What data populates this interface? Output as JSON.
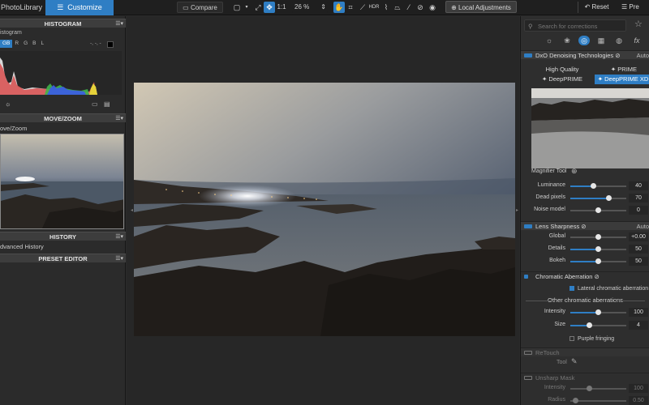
{
  "topbar": {
    "tab_photolibrary": "PhotoLibrary",
    "tab_customize": "Customize",
    "compare_label": "Compare",
    "zoom_one_to_one": "1:1",
    "zoom_level": "26 %",
    "local_adjustments_label": "Local Adjustments",
    "reset_label": "Reset",
    "preset_label": "Pre"
  },
  "left": {
    "histogram_title": "HISTOGRAM",
    "histogram_label": "istogram",
    "channels": [
      "GB",
      "R",
      "G",
      "B",
      "L"
    ],
    "histogram_readout": "-, -, -",
    "move_zoom_title": "MOVE/ZOOM",
    "move_zoom_label": "ove/Zoom",
    "history_title": "HISTORY",
    "history_item": "dvanced History",
    "preset_editor_title": "PRESET EDITOR"
  },
  "right": {
    "search_placeholder": "Search for corrections",
    "denoise": {
      "title": "DxO Denoising Technologies",
      "auto": "Auto",
      "mode_high_quality": "High Quality",
      "mode_prime": "PRIME",
      "mode_deepprime": "DeepPRIME",
      "mode_deepprime_xd": "DeepPRIME XD",
      "magnifier_label": "Magnifier Tool",
      "sliders": [
        {
          "label": "Luminance",
          "value": "40",
          "pct": 0.4
        },
        {
          "label": "Dead pixels",
          "value": "70",
          "pct": 0.68
        },
        {
          "label": "Noise model",
          "value": "0",
          "pct": 0.5
        }
      ]
    },
    "lens_sharpness": {
      "title": "Lens Sharpness",
      "auto": "Auto",
      "sliders": [
        {
          "label": "Global",
          "value": "+0.00",
          "pct": 0.5
        },
        {
          "label": "Details",
          "value": "50",
          "pct": 0.5
        },
        {
          "label": "Bokeh",
          "value": "50",
          "pct": 0.5
        }
      ]
    },
    "chromatic": {
      "title": "Chromatic Aberration",
      "lateral_label": "Lateral chromatic aberration",
      "other_label": "Other chromatic aberrations",
      "sliders": [
        {
          "label": "Intensity",
          "value": "100",
          "pct": 0.5
        },
        {
          "label": "Size",
          "value": "4",
          "pct": 0.33
        }
      ],
      "purple_label": "Purple fringing"
    },
    "retouch": {
      "title": "ReTouch",
      "tool_label": "Tool"
    },
    "unsharp": {
      "title": "Unsharp Mask",
      "sliders": [
        {
          "label": "Intensity",
          "value": "100",
          "pct": 0.33
        },
        {
          "label": "Radius",
          "value": "0.50",
          "pct": 0.08
        }
      ]
    }
  },
  "colors": {
    "accent": "#2f7ec4",
    "panel": "#2b2b2b",
    "header": "#3d3d3d"
  }
}
